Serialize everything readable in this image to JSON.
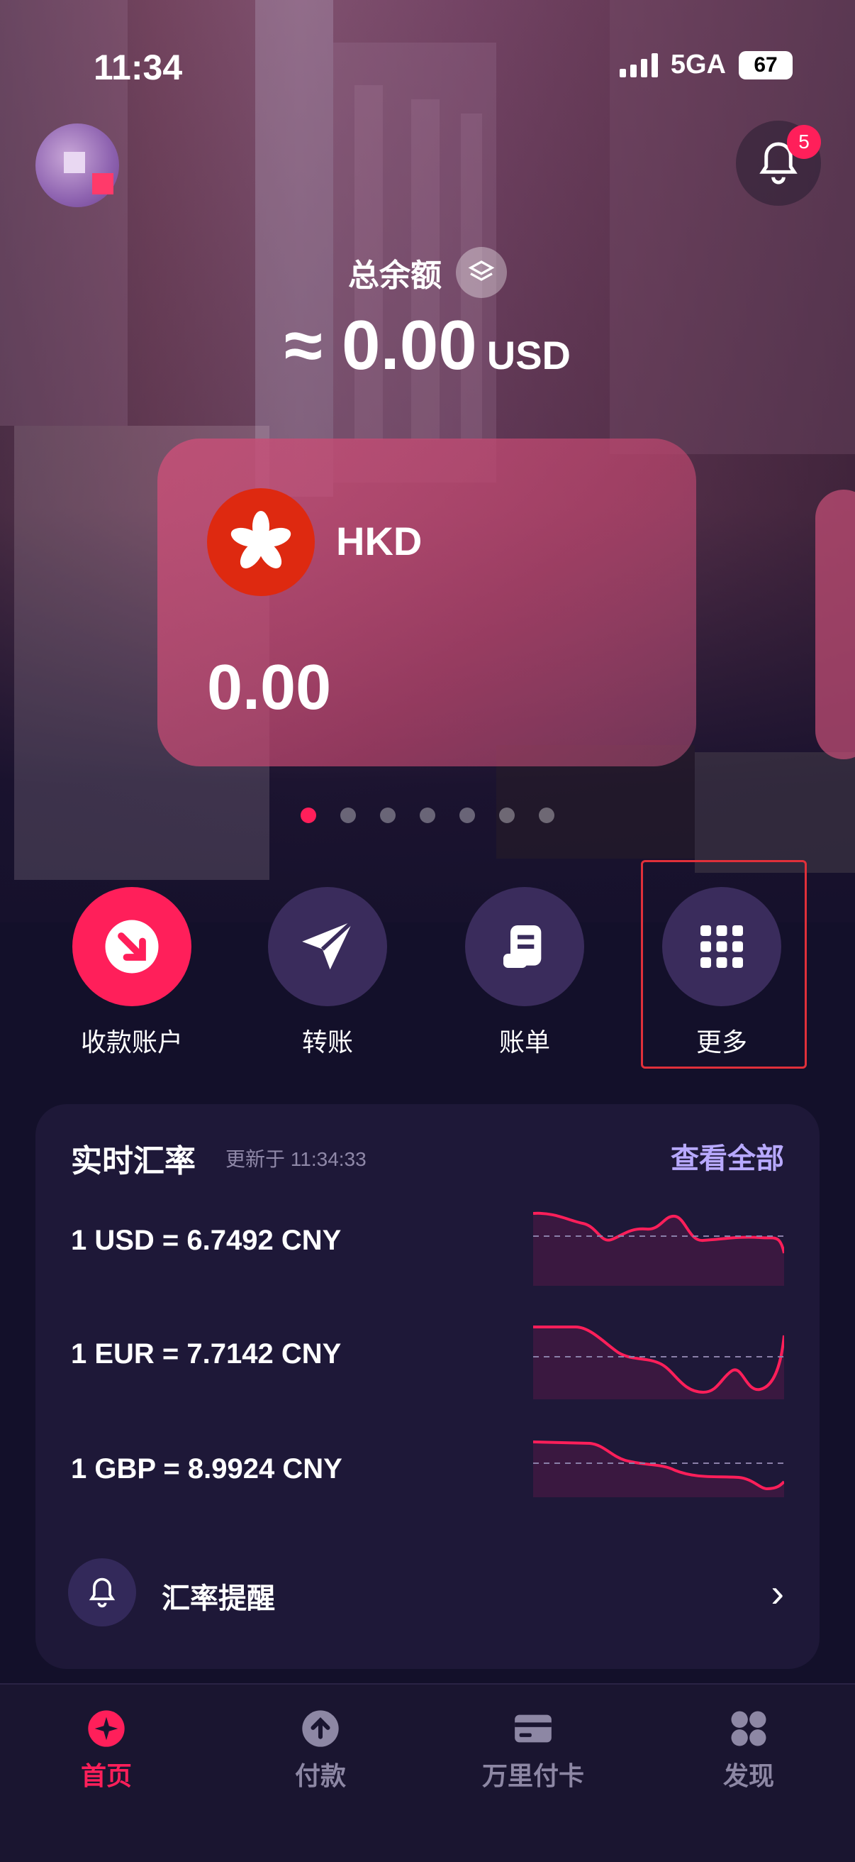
{
  "status": {
    "time": "11:34",
    "network": "5GA",
    "battery": "67"
  },
  "header": {
    "notifications": "5"
  },
  "balance": {
    "label": "总余额",
    "amount": "≈ 0.00",
    "currency": "USD"
  },
  "card": {
    "currency": "HKD",
    "amount": "0.00"
  },
  "pager": {
    "count": 7,
    "active": 0
  },
  "actions": [
    {
      "label": "收款账户",
      "icon": "arrow-down-right-icon"
    },
    {
      "label": "转账",
      "icon": "paper-plane-icon"
    },
    {
      "label": "账单",
      "icon": "receipt-icon"
    },
    {
      "label": "更多",
      "icon": "grid-icon"
    }
  ],
  "fx": {
    "title": "实时汇率",
    "updated": "更新于 11:34:33",
    "view_all": "查看全部",
    "rows": [
      {
        "text": "1 USD = 6.7492 CNY"
      },
      {
        "text": "1 EUR = 7.7142 CNY"
      },
      {
        "text": "1 GBP = 8.9924 CNY"
      }
    ],
    "alert_label": "汇率提醒"
  },
  "tabs": [
    {
      "label": "首页",
      "icon": "home-star-icon",
      "active": true
    },
    {
      "label": "付款",
      "icon": "upload-icon",
      "active": false
    },
    {
      "label": "万里付卡",
      "icon": "card-icon",
      "active": false
    },
    {
      "label": "发现",
      "icon": "discover-icon",
      "active": false
    }
  ],
  "colors": {
    "accent": "#ff1f5a",
    "panel": "#1e1838",
    "link": "#b8a9ff"
  }
}
